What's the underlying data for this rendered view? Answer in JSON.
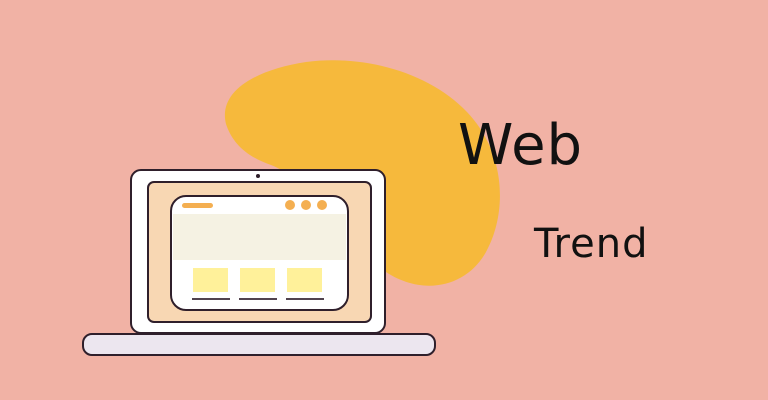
{
  "title": {
    "line1": "Web",
    "line2": "Trend"
  },
  "colors": {
    "background": "#F1B2A5",
    "blob": "#F6B93C",
    "laptop_body": "#FFFFFF",
    "laptop_outline": "#2F1F2B",
    "screen_frame": "#F8D7B3",
    "browser_content": "#F5F2E3",
    "browser_dots": "#F4AF51",
    "cards": "#FFF19A",
    "card_lines": "#51434E",
    "base": "#ECE6EF",
    "text": "#111111"
  },
  "icons": {
    "device": "laptop-icon",
    "browser_controls": "window-dots-icon"
  }
}
